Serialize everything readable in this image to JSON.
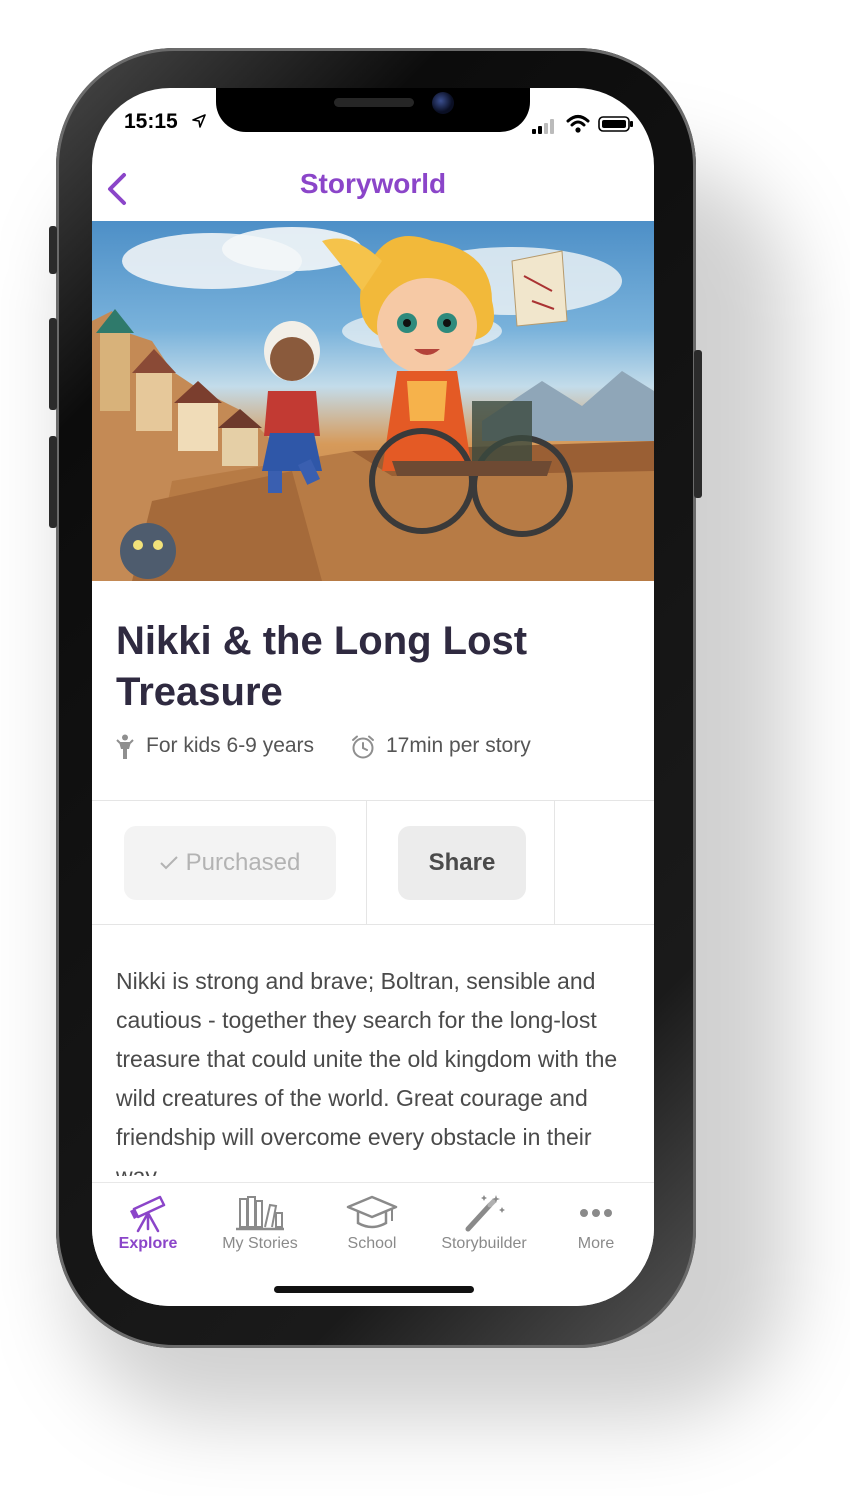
{
  "status_bar": {
    "time": "15:15"
  },
  "nav": {
    "title": "Storyworld"
  },
  "story": {
    "title": "Nikki & the Long Lost Treasure",
    "age": "For kids 6-9 years",
    "duration": "17min per story",
    "description": "Nikki is strong and brave; Boltran, sensible and cautious - together they search for the long-lost treasure that could unite the old kingdom with the wild creatures of the world. Great courage and friendship will overcome every obstacle in their way."
  },
  "actions": {
    "purchased_label": "Purchased",
    "share_label": "Share"
  },
  "tabs": [
    {
      "label": "Explore",
      "icon": "telescope-icon",
      "active": true
    },
    {
      "label": "My Stories",
      "icon": "bookshelf-icon",
      "active": false
    },
    {
      "label": "School",
      "icon": "graduation-cap-icon",
      "active": false
    },
    {
      "label": "Storybuilder",
      "icon": "magic-wand-icon",
      "active": false
    },
    {
      "label": "More",
      "icon": "more-dots-icon",
      "active": false
    }
  ],
  "colors": {
    "accent": "#8b45c9",
    "title": "#2f2a40"
  }
}
